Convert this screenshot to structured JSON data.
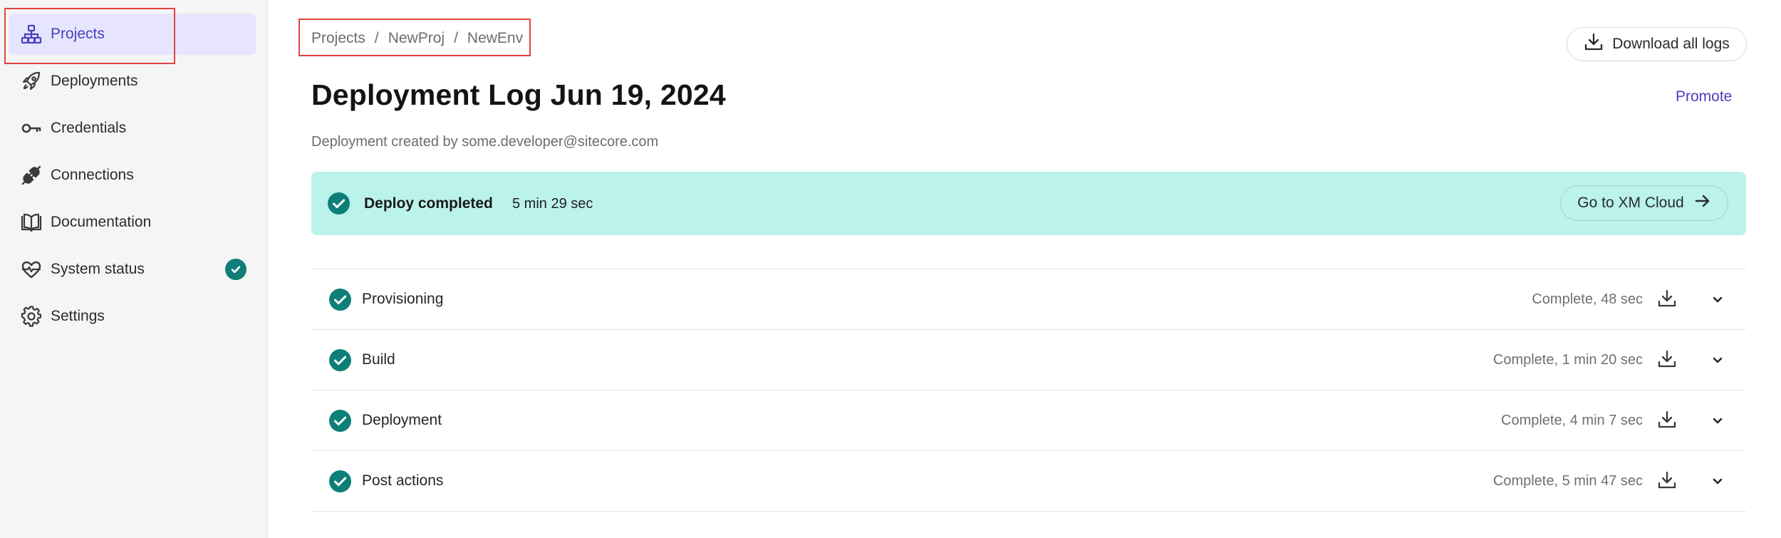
{
  "sidebar": {
    "items": [
      {
        "label": "Projects",
        "icon": "sitemap-icon",
        "active": true
      },
      {
        "label": "Deployments",
        "icon": "rocket-icon"
      },
      {
        "label": "Credentials",
        "icon": "key-icon"
      },
      {
        "label": "Connections",
        "icon": "plug-icon"
      },
      {
        "label": "Documentation",
        "icon": "book-icon"
      },
      {
        "label": "System status",
        "icon": "heartbeat-icon",
        "status_icon": "check-circle-icon"
      },
      {
        "label": "Settings",
        "icon": "gear-icon"
      }
    ]
  },
  "breadcrumb": {
    "items": [
      "Projects",
      "NewProj",
      "NewEnv"
    ],
    "separator": "/"
  },
  "header": {
    "download_all_label": "Download all logs",
    "title": "Deployment Log Jun 19, 2024",
    "promote_label": "Promote",
    "subtitle": "Deployment created by some.developer@sitecore.com"
  },
  "banner": {
    "label": "Deploy completed",
    "duration": "5 min 29 sec",
    "button_label": "Go to XM Cloud"
  },
  "steps": [
    {
      "label": "Provisioning",
      "status": "Complete, 48 sec"
    },
    {
      "label": "Build",
      "status": "Complete, 1 min 20 sec"
    },
    {
      "label": "Deployment",
      "status": "Complete, 4 min 7 sec"
    },
    {
      "label": "Post actions",
      "status": "Complete, 5 min 47 sec"
    }
  ],
  "colors": {
    "accent": "#4a3fbf",
    "success": "#0e7f78",
    "banner_bg": "#bbf2ec",
    "active_nav_bg": "#e7e5fd",
    "highlight": "#e0433f"
  }
}
